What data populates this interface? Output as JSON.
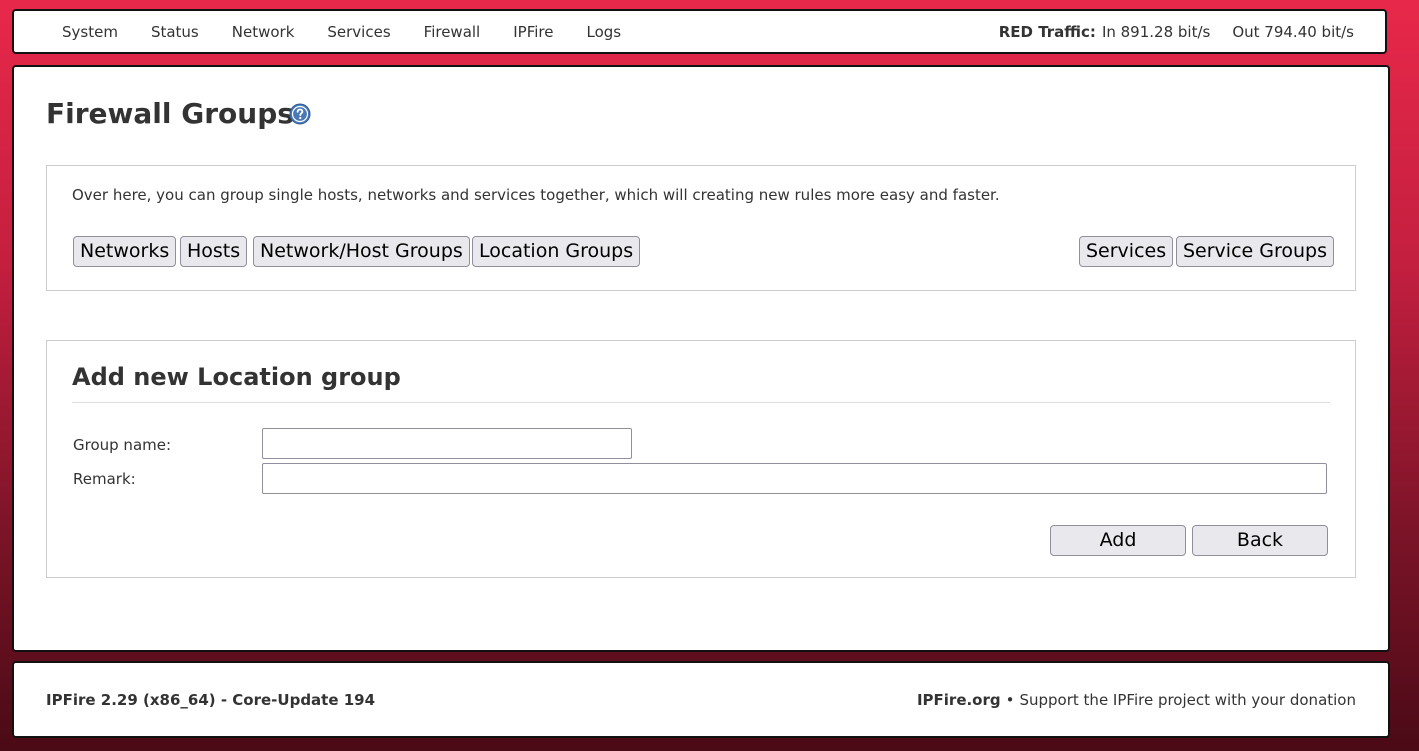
{
  "nav": {
    "menu": [
      "System",
      "Status",
      "Network",
      "Services",
      "Firewall",
      "IPFire",
      "Logs"
    ],
    "traffic_label": "RED Traffic:",
    "traffic_in": "In 891.28 bit/s",
    "traffic_out": "Out 794.40 bit/s"
  },
  "page": {
    "title": "Firewall Groups",
    "help_icon": "question-circle-icon"
  },
  "groups_box": {
    "intro": "Over here, you can group single hosts, networks and services together, which will creating new rules more easy and faster.",
    "left_buttons": [
      "Networks",
      "Hosts",
      "Network/Host Groups",
      "Location Groups"
    ],
    "right_buttons": [
      "Services",
      "Service Groups"
    ]
  },
  "form": {
    "title": "Add new Location group",
    "group_name_label": "Group name:",
    "group_name_value": "",
    "remark_label": "Remark:",
    "remark_value": "",
    "add_label": "Add",
    "back_label": "Back"
  },
  "footer": {
    "version": "IPFire 2.29 (x86_64) - Core-Update 194",
    "site": "IPFire.org",
    "separator": "•",
    "donation": "Support the IPFire project with your donation"
  },
  "colors": {
    "background_top": "#e8284a",
    "background_bottom": "#4a0a16",
    "help_icon": "#4a79b8"
  }
}
